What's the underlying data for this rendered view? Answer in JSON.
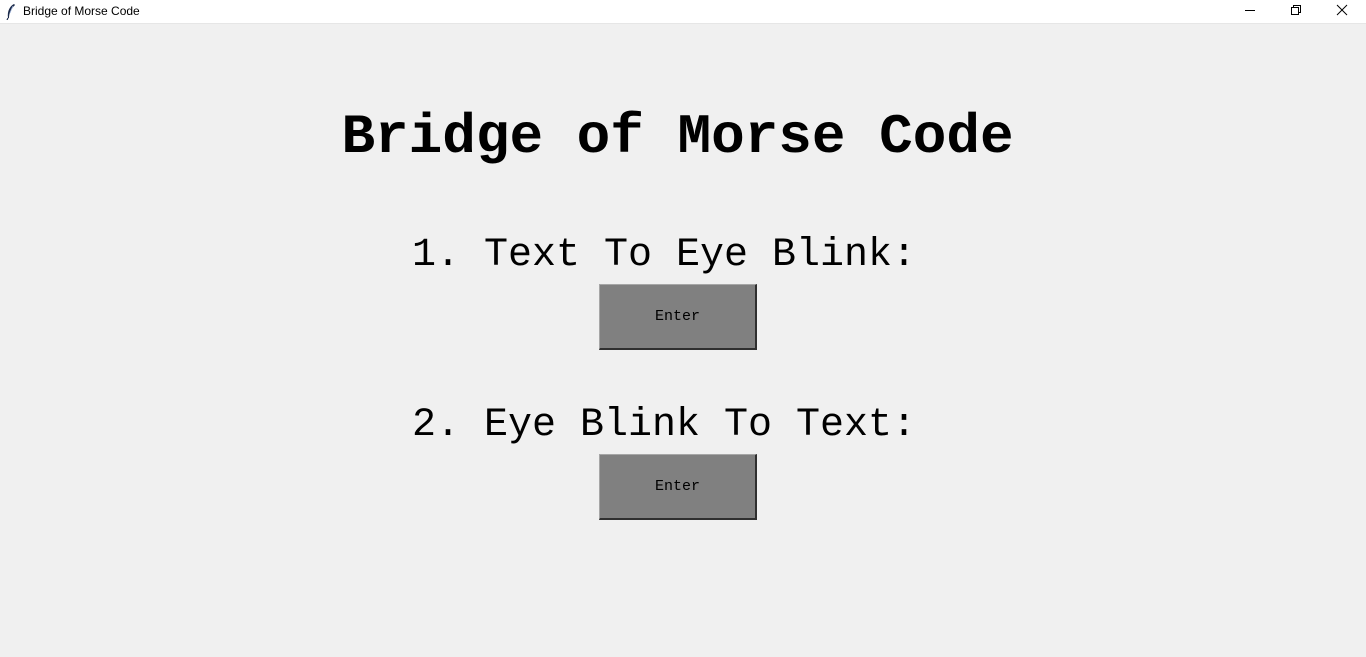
{
  "window": {
    "title": "Bridge of Morse Code"
  },
  "main": {
    "title": "Bridge of Morse Code",
    "sections": [
      {
        "label": "1. Text To Eye Blink:",
        "button_label": "Enter"
      },
      {
        "label": "2. Eye Blink To Text:",
        "button_label": "Enter"
      }
    ]
  },
  "icons": {
    "app": "feather-icon",
    "minimize": "minimize-icon",
    "maximize": "restore-icon",
    "close": "close-icon"
  },
  "colors": {
    "background": "#f0f0f0",
    "titlebar": "#ffffff",
    "button": "#808080",
    "text": "#000000"
  }
}
